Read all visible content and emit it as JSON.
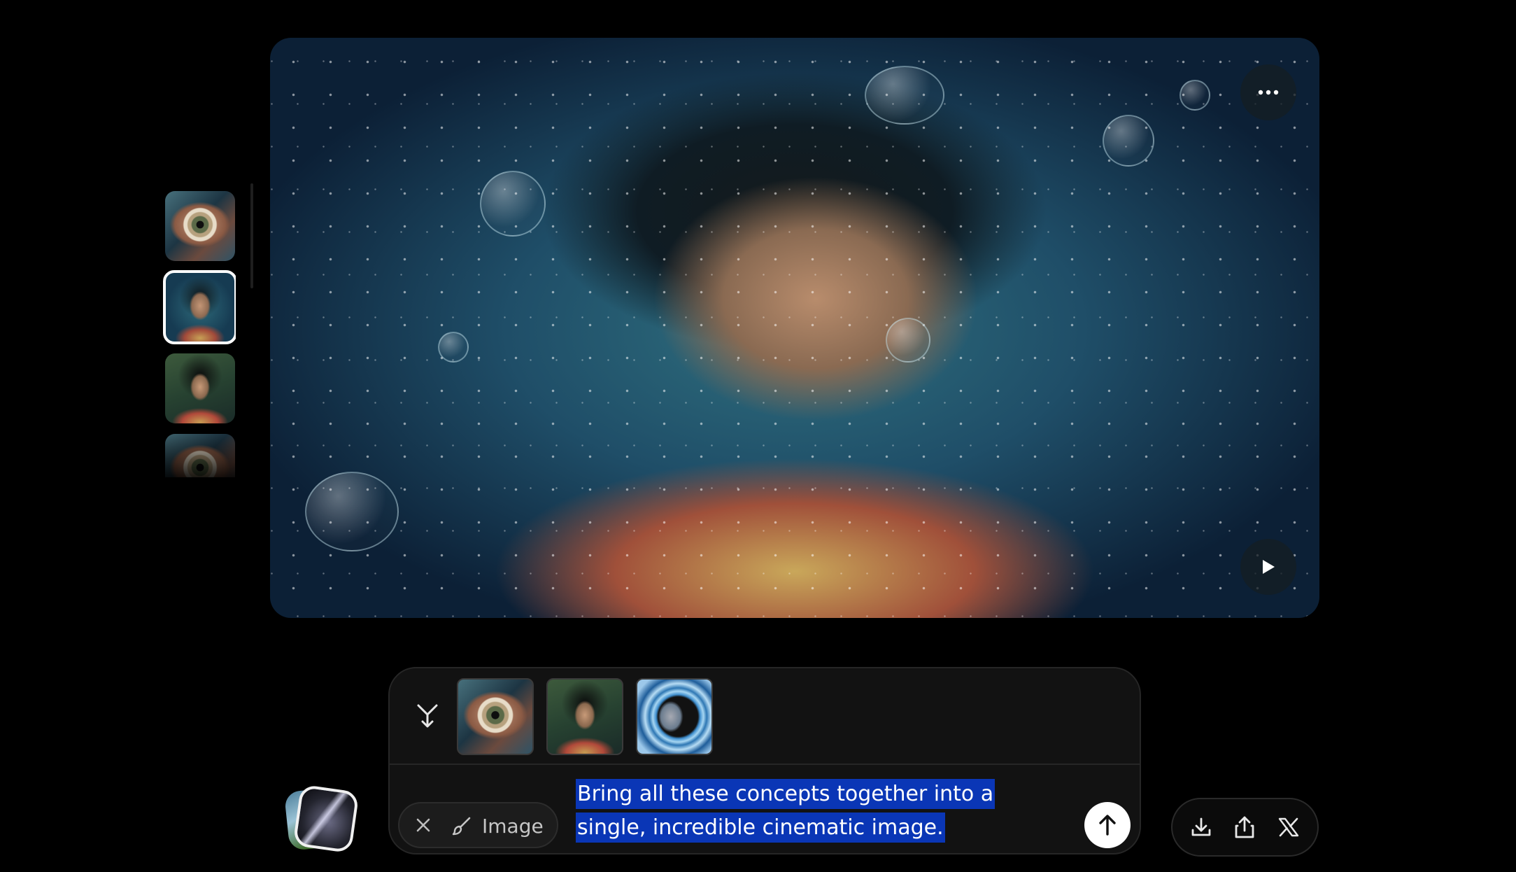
{
  "preview": {
    "more_icon": "more-horizontal-icon",
    "play_icon": "play-icon"
  },
  "rail": {
    "items": [
      {
        "icon": "eye-artwork-thumbnail",
        "selected": false
      },
      {
        "icon": "underwater-woman-thumbnail",
        "selected": true
      },
      {
        "icon": "woman-portrait-thumbnail",
        "selected": false
      },
      {
        "icon": "eye-artwork-thumbnail",
        "selected": false
      }
    ]
  },
  "composer": {
    "merge_icon": "merge-icon",
    "references": [
      {
        "icon": "eye-artwork-thumbnail"
      },
      {
        "icon": "woman-portrait-thumbnail"
      },
      {
        "icon": "water-portal-thumbnail"
      }
    ],
    "mode": {
      "label": "Image",
      "close_icon": "close-icon",
      "brush_icon": "brush-icon"
    },
    "prompt_line1": "Bring all these concepts together into a",
    "prompt_line2": "single, incredible cinematic image.",
    "send_icon": "arrow-up-icon"
  },
  "actions": {
    "download_icon": "download-icon",
    "share_icon": "share-icon",
    "x_icon": "x-logo-icon"
  },
  "colors": {
    "background": "#000000",
    "selection_highlight": "#0a36b6",
    "panel": "#121212"
  }
}
